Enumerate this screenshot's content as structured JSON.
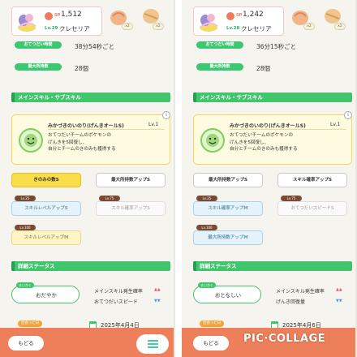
{
  "left": {
    "sp_label": "SP",
    "sp_value": "1,512",
    "level": "Lv.29",
    "pokemon_name": "クレセリア",
    "berry_badges": [
      "x2",
      "x2"
    ],
    "stats": [
      {
        "label": "おてつだい時間",
        "value": "38分54秒ごと"
      },
      {
        "label": "最大所持数",
        "value": "28個"
      }
    ],
    "section_skill": "メインスキル・サブスキル",
    "main_skill": {
      "name": "みかづきのいのり(げんきオールS)",
      "level": "Lv.1",
      "description": "おてつだいチームのポケモンの\nげんきを5回復し、\n自分とチームのきのみも獲得する"
    },
    "sub_skills": [
      {
        "label": "きのみの数S",
        "lock": ""
      },
      {
        "label": "最大所持数アップS",
        "lock": ""
      },
      {
        "label": "スキルレベルアップS",
        "lock": "Lv.25"
      },
      {
        "label": "スキル確率アップS",
        "lock": "Lv.75"
      },
      {
        "label": "スキルレベルアップM",
        "lock": "Lv.100"
      }
    ],
    "section_detail": "詳細ステータス",
    "nature_tag": "せいかく",
    "nature": "おだやか",
    "effects": [
      "メインスキル発生確率",
      "おてつだいスピード"
    ],
    "date_tag": "出会った日",
    "date": "2025年4月4日",
    "back_label": "もどる"
  },
  "right": {
    "sp_label": "SP",
    "sp_value": "1,242",
    "level": "Lv.28",
    "pokemon_name": "クレセリア",
    "berry_badges": [
      "x2",
      "x2"
    ],
    "stats": [
      {
        "label": "おてつだい時間",
        "value": "36分15秒ごと"
      },
      {
        "label": "最大所持数",
        "value": "28個"
      }
    ],
    "section_skill": "メインスキル・サブスキル",
    "main_skill": {
      "name": "みかづきのいのり(げんきオールS)",
      "level": "Lv.1",
      "description": "おてつだいチームのポケモンの\nげんきを5回復し、\n自分とチームのきのみも獲得する"
    },
    "sub_skills": [
      {
        "label": "最大所持数アップS",
        "lock": ""
      },
      {
        "label": "スキル確率アップS",
        "lock": ""
      },
      {
        "label": "スキル確率アップM",
        "lock": "Lv.25"
      },
      {
        "label": "おてつだいスピードS",
        "lock": "Lv.75"
      },
      {
        "label": "最大所持数アップM",
        "lock": "Lv.100"
      }
    ],
    "section_detail": "詳細ステータス",
    "nature_tag": "せいかく",
    "nature": "おとなしい",
    "effects": [
      "メインスキル発生確率",
      "げんき回復量"
    ],
    "date_tag": "出会った日",
    "date": "2025年4月6日",
    "back_label": "もどる"
  },
  "watermark": "PIC·COLLAGE"
}
